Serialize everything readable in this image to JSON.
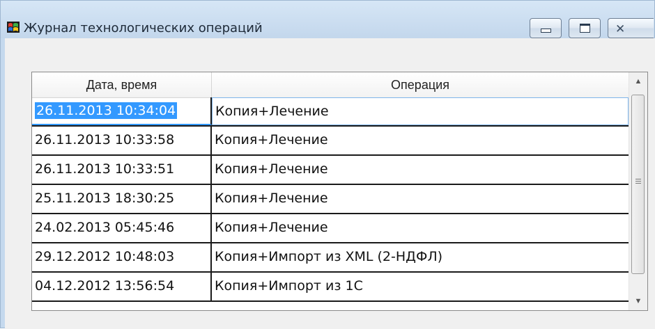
{
  "window": {
    "title": "Журнал технологических операций",
    "icon": "windows-flag-app-icon",
    "controls": [
      "minimize-icon",
      "maximize-icon",
      "close-icon"
    ],
    "close_glyph": "✕"
  },
  "grid": {
    "columns": [
      "Дата, время",
      "Операция"
    ],
    "rows": [
      {
        "date": "26.11.2013 10:34:04",
        "operation": "Копия+Лечение",
        "selected": true
      },
      {
        "date": "26.11.2013 10:33:58",
        "operation": "Копия+Лечение"
      },
      {
        "date": "26.11.2013 10:33:51",
        "operation": "Копия+Лечение"
      },
      {
        "date": "25.11.2013 18:30:25",
        "operation": "Копия+Лечение"
      },
      {
        "date": "24.02.2013 05:45:46",
        "operation": "Копия+Лечение"
      },
      {
        "date": "29.12.2012 10:48:03",
        "operation": "Копия+Импорт из XML (2-НДФЛ)"
      },
      {
        "date": "04.12.2012 13:56:54",
        "operation": "Копия+Импорт из 1С"
      }
    ],
    "scroll_up_glyph": "▲",
    "scroll_down_glyph": "▼"
  },
  "colors": {
    "selection": "#3399ff",
    "titlebar": "#c5d9ee"
  }
}
